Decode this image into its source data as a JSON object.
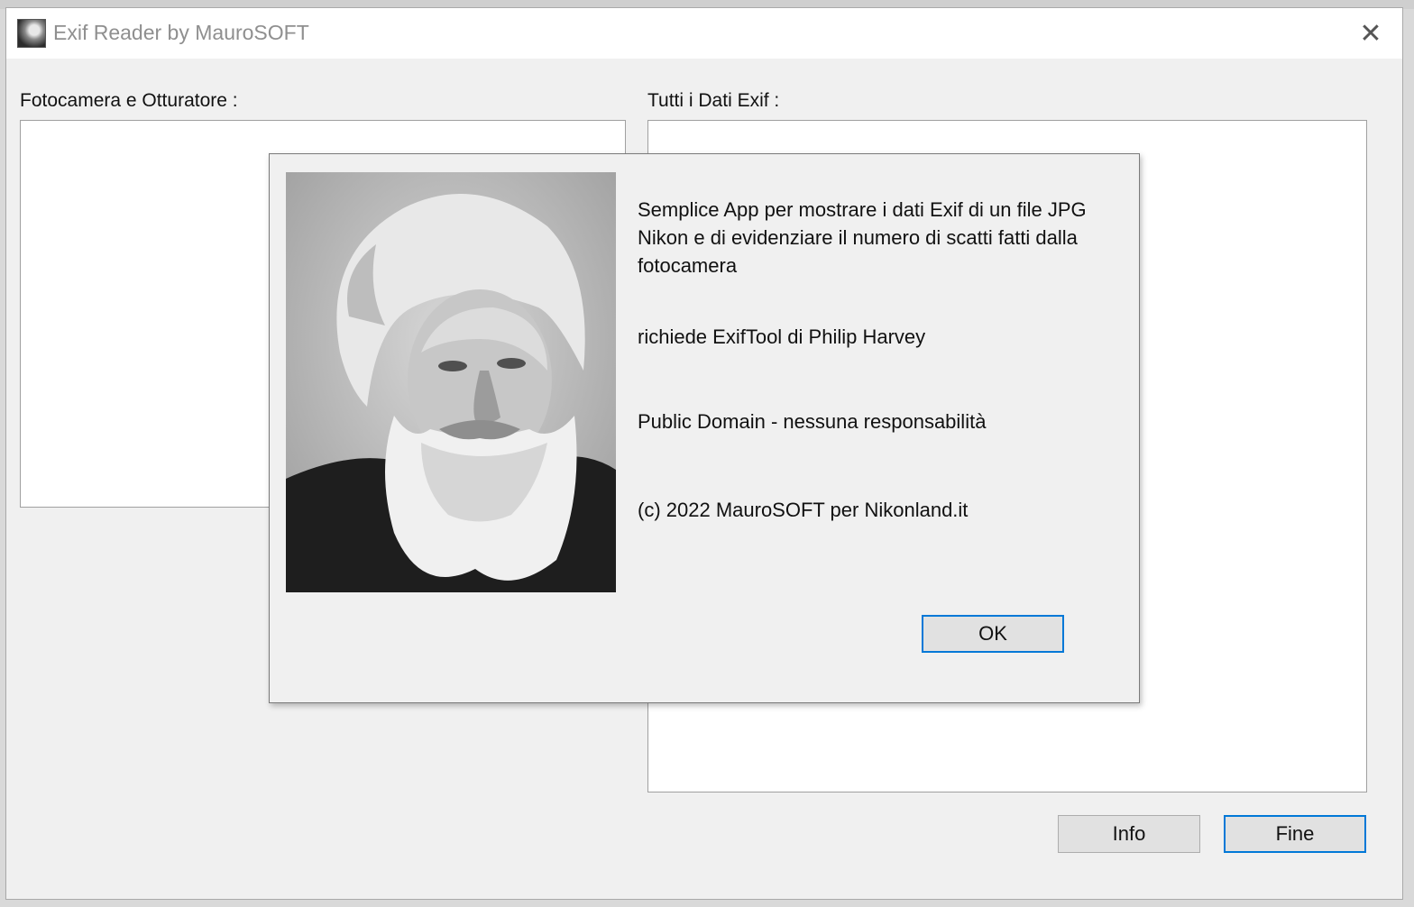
{
  "window": {
    "title": "Exif Reader by MauroSOFT",
    "close_symbol": "✕"
  },
  "labels": {
    "camera_shutter": "Fotocamera e Otturatore :",
    "all_exif": "Tutti i Dati Exif :"
  },
  "buttons": {
    "info": "Info",
    "fine": "Fine"
  },
  "dialog": {
    "description": "Semplice App per mostrare i dati Exif di un file JPG Nikon e di evidenziare il numero di scatti fatti dalla fotocamera",
    "requires": "richiede ExifTool di Philip Harvey",
    "license": "Public Domain - nessuna responsabilità",
    "copyright": "(c) 2022 MauroSOFT per Nikonland.it",
    "ok": "OK"
  },
  "colors": {
    "accent": "#0078d7",
    "window_bg": "#f0f0f0",
    "titlebar_bg": "#ffffff"
  }
}
